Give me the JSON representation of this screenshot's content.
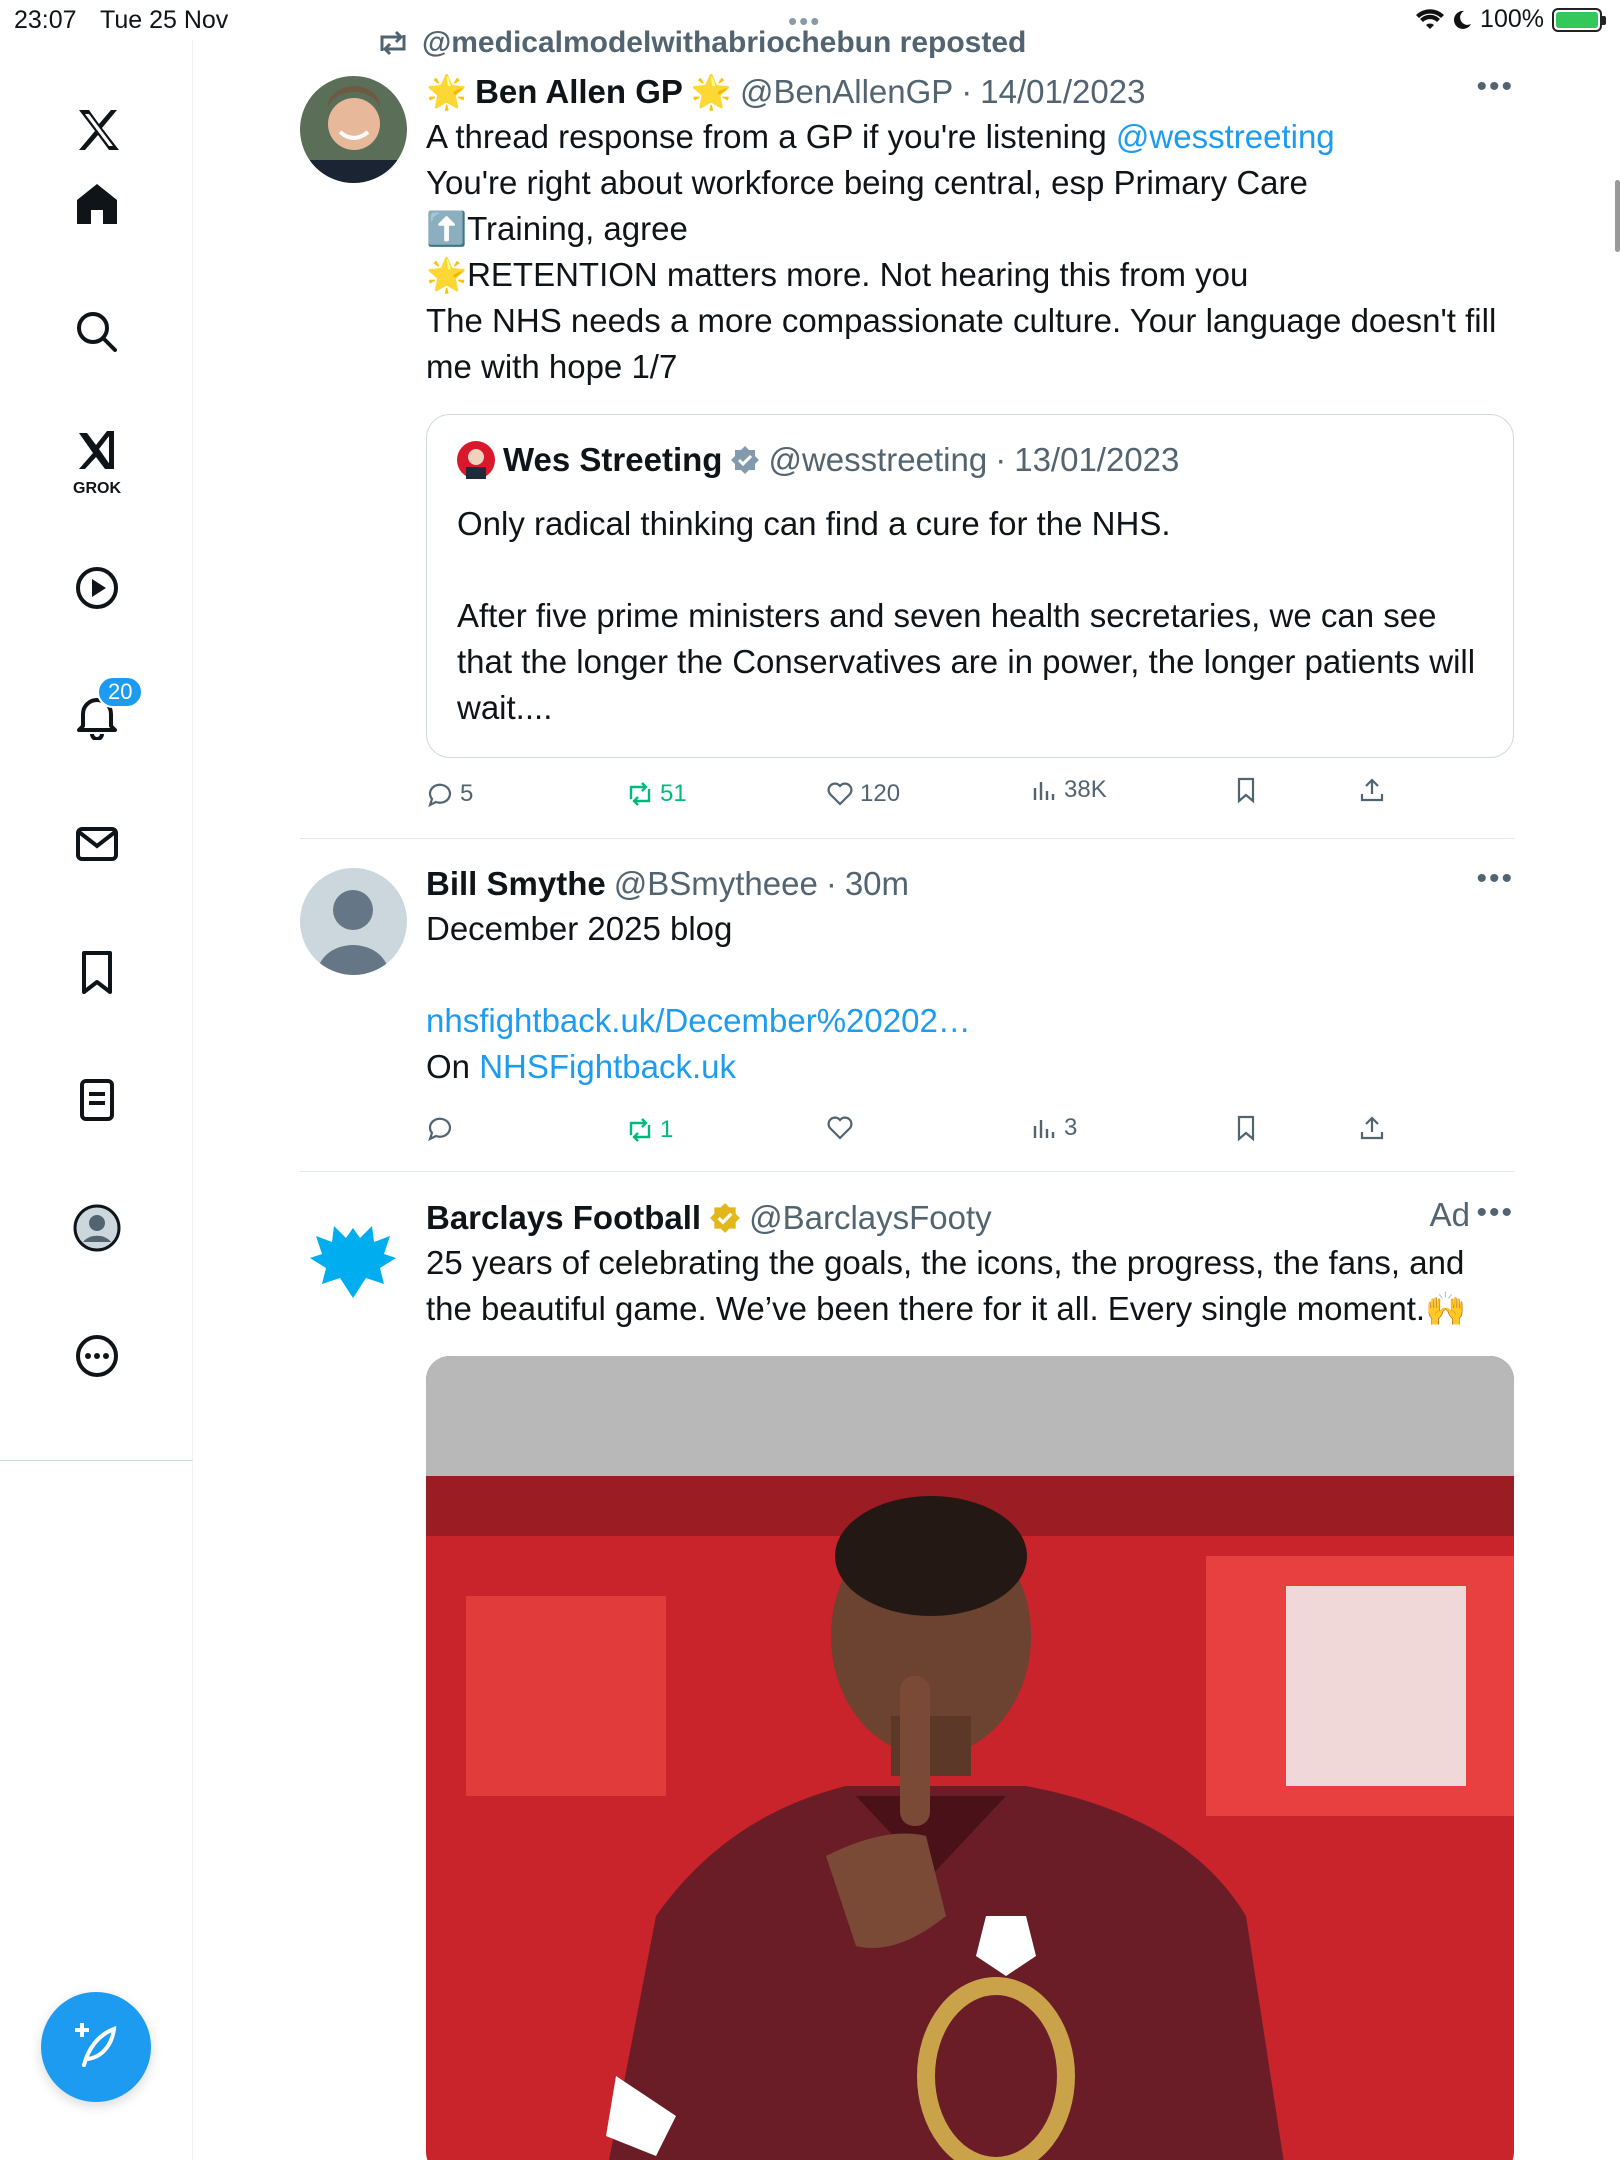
{
  "status_bar": {
    "time": "23:07",
    "date": "Tue 25 Nov",
    "battery": "100%"
  },
  "sidebar": {
    "grok_label": "GROK",
    "notifications_badge": "20"
  },
  "repost": {
    "text": "@medicalmodelwithabriochebun reposted"
  },
  "tweets": [
    {
      "name": "Ben Allen GP",
      "name_emoji_left": "🌟",
      "name_emoji_right": "🌟",
      "handle": "@BenAllenGP",
      "time": "14/01/2023",
      "text_line1": "A thread response from a GP if you're listening ",
      "mention": "@wesstreeting",
      "text_rest": "You're right about workforce being central, esp Primary Care\n⬆️Training, agree\n🌟RETENTION matters more. Not hearing this from you\nThe NHS needs a more compassionate culture. Your language doesn't fill me with hope 1/7",
      "quote": {
        "name": "Wes Streeting",
        "handle": "@wesstreeting",
        "time": "13/01/2023",
        "text": "Only radical thinking can find a cure for the NHS.\n\nAfter five prime ministers and seven health secretaries, we can see that the longer the Conservatives are in power, the longer patients will wait...."
      },
      "replies": "5",
      "reposts": "51",
      "likes": "120",
      "views": "38K"
    },
    {
      "name": "Bill Smythe",
      "handle": "@BSmytheee",
      "time": "30m",
      "text": "December 2025 blog",
      "link": "nhsfightback.uk/December%20202…",
      "on_prefix": "On ",
      "on_link": "NHSFightback.uk",
      "replies": "",
      "reposts": "1",
      "likes": "",
      "views": "3"
    },
    {
      "name": "Barclays Football",
      "handle": "@BarclaysFooty",
      "ad_label": "Ad",
      "text": "25 years of celebrating the goals, the icons, the progress, the fans, and the beautiful game. We’ve been there for it all. Every single moment.🙌"
    }
  ],
  "colors": {
    "accent": "#1d9bf0",
    "repost_green": "#00ba7c",
    "secondary_text": "#536471",
    "verified_gold": "#e2b719",
    "verified_grey": "#829aab"
  }
}
